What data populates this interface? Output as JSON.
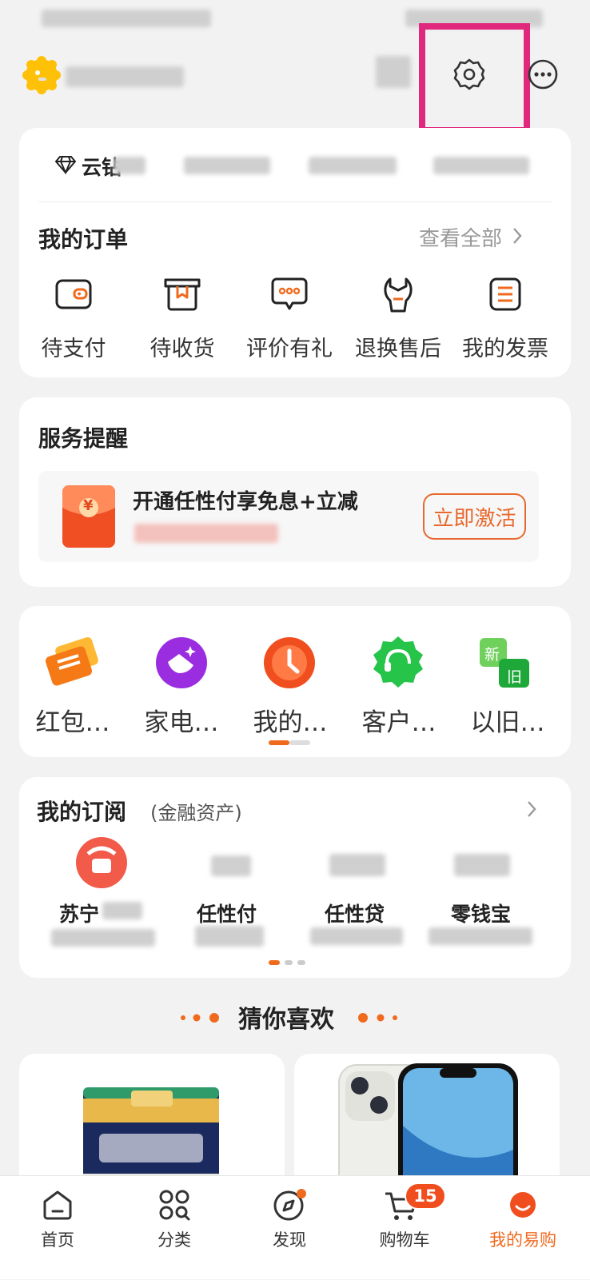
{
  "orders": {
    "title": "我的订单",
    "view_all": "查看全部",
    "items": [
      {
        "label": "待支付"
      },
      {
        "label": "待收货"
      },
      {
        "label": "评价有礼"
      },
      {
        "label": "退换售后"
      },
      {
        "label": "我的发票"
      }
    ]
  },
  "member": {
    "level_text": "云钻"
  },
  "service": {
    "title": "服务提醒",
    "promo_title": "开通任性付享免息+立减",
    "button": "立即激活",
    "envelope_symbol": "¥"
  },
  "tools": {
    "items": [
      {
        "label": "红包…",
        "icon": "coupon-icon"
      },
      {
        "label": "家电…",
        "icon": "appliance-service-icon"
      },
      {
        "label": "我的…",
        "icon": "clock-icon"
      },
      {
        "label": "客户…",
        "icon": "customer-service-icon"
      },
      {
        "label": "以旧…",
        "icon": "trade-in-icon"
      }
    ],
    "trade_in_new": "新",
    "trade_in_old": "旧"
  },
  "subscriptions": {
    "title": "我的订阅",
    "subtitle": "(金融资产)",
    "items": [
      {
        "label": "苏宁"
      },
      {
        "label": "任性付"
      },
      {
        "label": "任性贷"
      },
      {
        "label": "零钱宝"
      }
    ]
  },
  "recommend": {
    "title": "猜你喜欢"
  },
  "nav": {
    "items": [
      {
        "label": "首页",
        "icon": "home-icon"
      },
      {
        "label": "分类",
        "icon": "category-icon"
      },
      {
        "label": "发现",
        "icon": "discover-icon"
      },
      {
        "label": "购物车",
        "icon": "cart-icon",
        "badge": "15"
      },
      {
        "label": "我的易购",
        "icon": "profile-icon"
      }
    ]
  },
  "colors": {
    "accent": "#f06a1e",
    "highlight": "#e0287d",
    "text": "#222222"
  }
}
